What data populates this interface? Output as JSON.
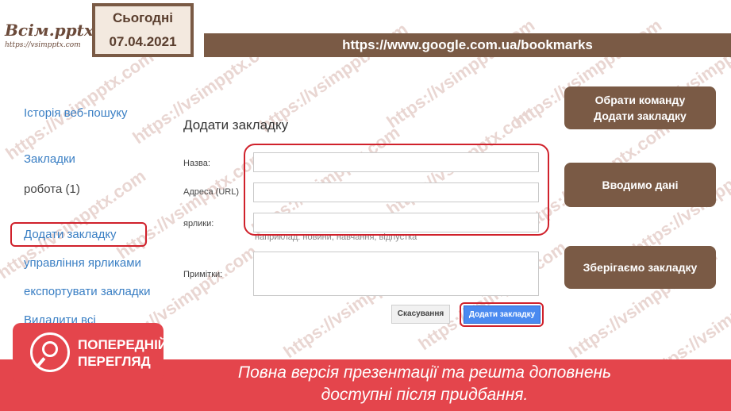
{
  "logo": {
    "title": "Всім.pptx",
    "subtitle": "https://vsimpptx.com"
  },
  "date_box": {
    "label": "Сьогодні",
    "date": "07.04.2021"
  },
  "url_bar": {
    "text": "https://www.google.com.ua/bookmarks"
  },
  "sidebar": {
    "items": [
      {
        "label": "Історія веб-пошуку"
      },
      {
        "label": "Закладки"
      },
      {
        "label": "робота (1)"
      },
      {
        "label": "Додати закладку"
      },
      {
        "label": "управління ярликами"
      },
      {
        "label": "експортувати закладки"
      },
      {
        "label": "Видалити всі"
      }
    ]
  },
  "form": {
    "title": "Додати закладку",
    "name_label": "Назва:",
    "url_label": "Адреса (URL)",
    "tags_label": "ярлики:",
    "tags_hint": "наприклад: новини, навчання, відпустка",
    "notes_label": "Примітки:",
    "cancel_label": "Скасування",
    "add_label": "Додати закладку"
  },
  "callouts": {
    "step1": "Обрати команду Додати закладку",
    "step2": "Вводимо дані",
    "step3": "Зберігаємо закладку"
  },
  "preview": {
    "line1": "ПОПЕРЕДНІЙ",
    "line2": "ПЕРЕГЛЯД"
  },
  "banner": {
    "line1": "Повна версія презентації та решта доповнень",
    "line2": "доступні після придбання."
  },
  "watermark": "https://vsimpptx.com",
  "colors": {
    "brown": "#7a5a45",
    "red": "#d0212b",
    "banner_red": "#e4454c",
    "link_blue": "#3a7fc4",
    "button_blue": "#4a8af0"
  }
}
